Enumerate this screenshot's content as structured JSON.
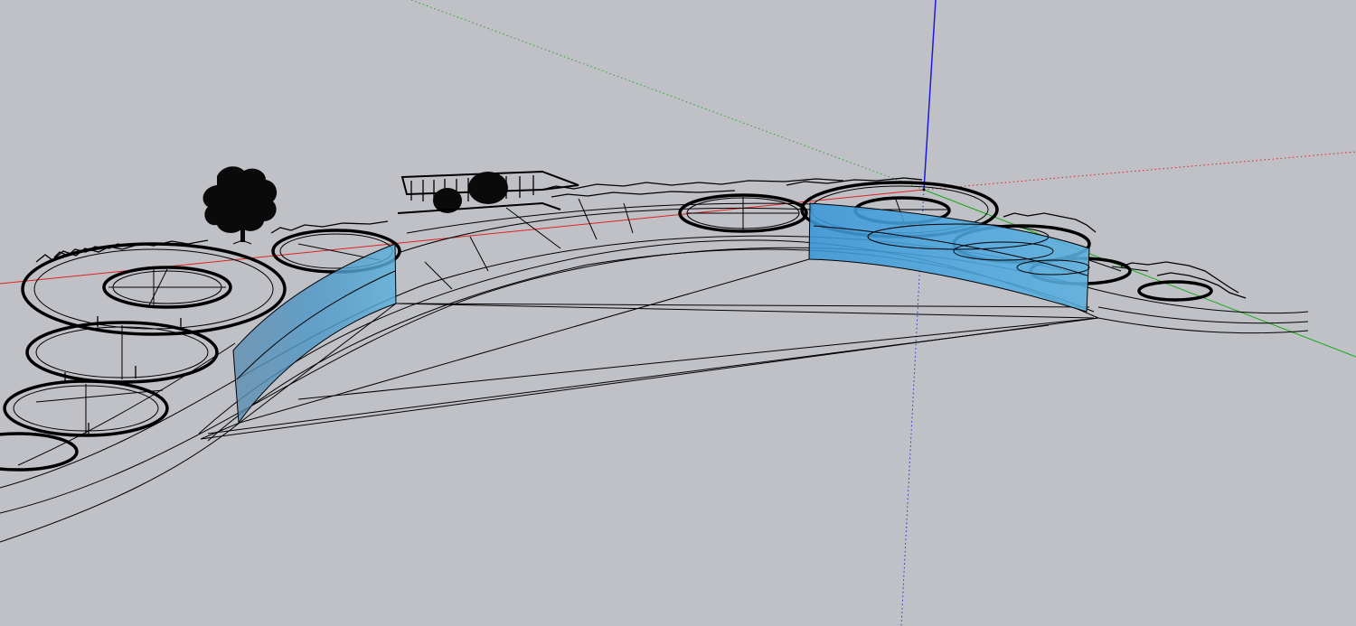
{
  "app": {
    "view": "3d-modeling-viewport",
    "render_style": "wireframe"
  },
  "axes": {
    "red_color": "#d00000",
    "green_color": "#00a000",
    "blue_color": "#0000e0"
  },
  "colors": {
    "background": "#c0c1c6",
    "edges": "#000000",
    "selection_fill": "#3d9ad8",
    "selection_fill_light": "#6fb4e0"
  },
  "model": {
    "selected_faces": 2,
    "tree_count": 1
  }
}
